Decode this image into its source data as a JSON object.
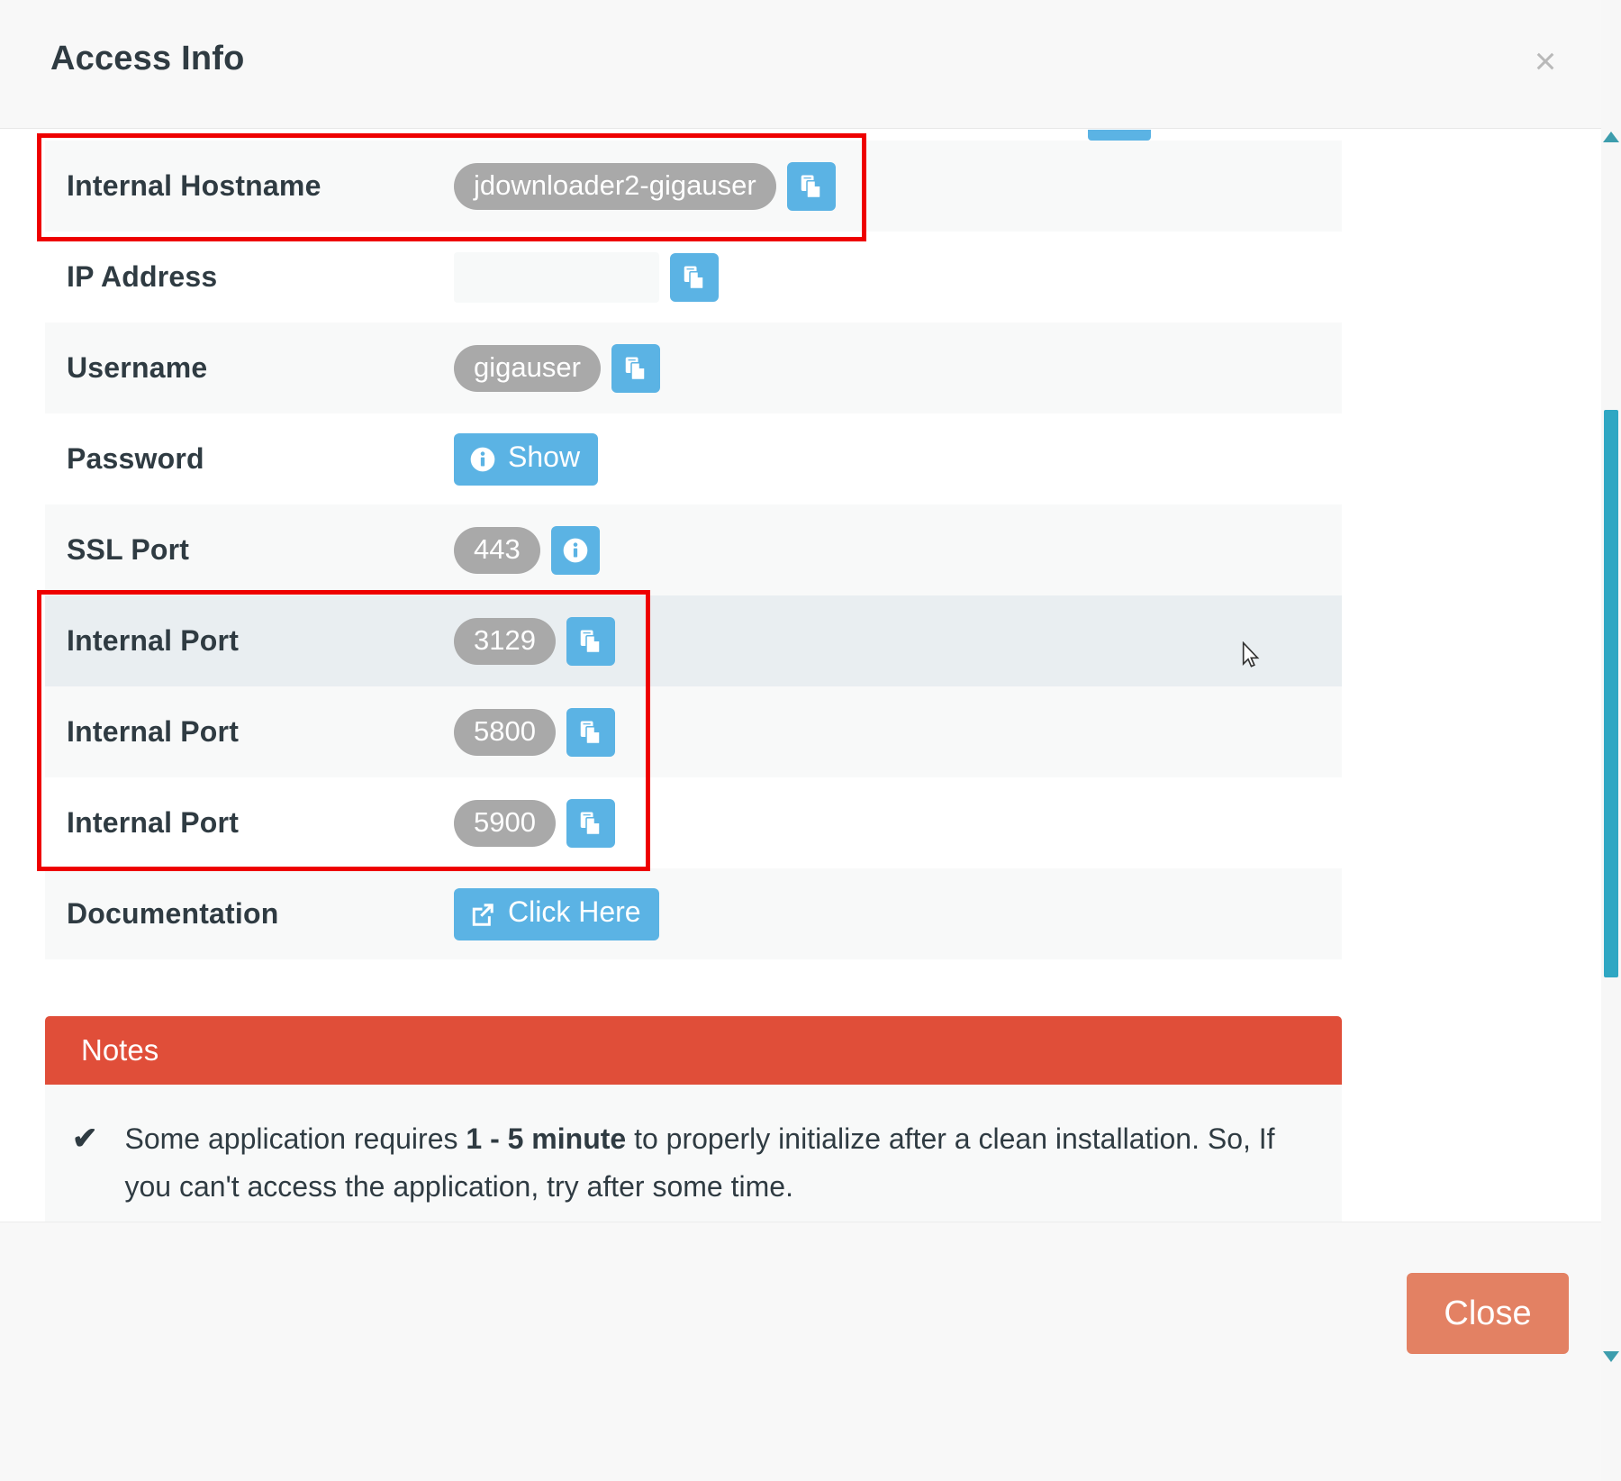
{
  "modal": {
    "title": "Access Info",
    "close_x": "×",
    "footer": {
      "close_label": "Close"
    }
  },
  "colors": {
    "accent_blue": "#5bb3e4",
    "badge_grey": "#a9a9a9",
    "notes_red": "#e04e39",
    "close_button": "#e38163",
    "annotation_red": "#ee0000",
    "scrollbar_teal": "#2fa7c3",
    "text_dark": "#2f3b42"
  },
  "rows": [
    {
      "label": "Internal Hostname",
      "value": "jdownloader2-gigauser",
      "value_kind": "badge",
      "action": {
        "type": "copy",
        "icon": "copy-icon",
        "label": ""
      },
      "striped": true,
      "highlighted": false
    },
    {
      "label": "IP Address",
      "value": "",
      "value_kind": "empty-field",
      "action": {
        "type": "copy",
        "icon": "copy-icon",
        "label": ""
      },
      "striped": false,
      "highlighted": false
    },
    {
      "label": "Username",
      "value": "gigauser",
      "value_kind": "badge",
      "action": {
        "type": "copy",
        "icon": "copy-icon",
        "label": ""
      },
      "striped": true,
      "highlighted": false
    },
    {
      "label": "Password",
      "value": "",
      "value_kind": "none",
      "action": {
        "type": "show",
        "icon": "info-circle-icon",
        "label": "Show"
      },
      "striped": false,
      "highlighted": false
    },
    {
      "label": "SSL Port",
      "value": "443",
      "value_kind": "badge",
      "action": {
        "type": "info",
        "icon": "info-circle-icon",
        "label": ""
      },
      "striped": true,
      "highlighted": false
    },
    {
      "label": "Internal Port",
      "value": "3129",
      "value_kind": "badge",
      "action": {
        "type": "copy",
        "icon": "copy-icon",
        "label": ""
      },
      "striped": false,
      "highlighted": true
    },
    {
      "label": "Internal Port",
      "value": "5800",
      "value_kind": "badge",
      "action": {
        "type": "copy",
        "icon": "copy-icon",
        "label": ""
      },
      "striped": true,
      "highlighted": false
    },
    {
      "label": "Internal Port",
      "value": "5900",
      "value_kind": "badge",
      "action": {
        "type": "copy",
        "icon": "copy-icon",
        "label": ""
      },
      "striped": false,
      "highlighted": false
    },
    {
      "label": "Documentation",
      "value": "",
      "value_kind": "none",
      "action": {
        "type": "link",
        "icon": "external-link-icon",
        "label": "Click Here"
      },
      "striped": true,
      "highlighted": false
    }
  ],
  "notes": {
    "header": "Notes",
    "items": [
      {
        "check": "✔",
        "text_before": "Some application requires ",
        "emphasis": "1 - 5 minute",
        "text_after": " to properly initialize after a clean installation. So, If you can't access the application, try after some time."
      }
    ]
  },
  "annotations": [
    {
      "name": "internal-hostname-highlight",
      "target": "Internal Hostname"
    },
    {
      "name": "internal-ports-highlight",
      "target": "Internal Port rows"
    }
  ],
  "scrollbar": {
    "up_arrow": "▲",
    "down_arrow": "▼"
  }
}
